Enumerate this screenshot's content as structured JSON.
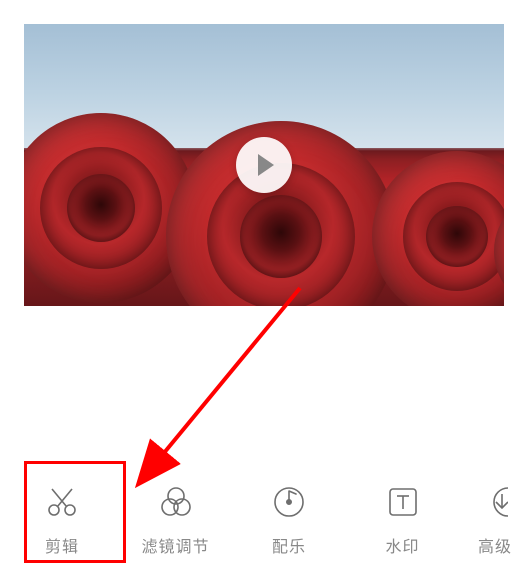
{
  "video": {
    "play_icon_name": "play-icon"
  },
  "toolbar": {
    "items": [
      {
        "label": "剪辑",
        "icon": "scissors-icon"
      },
      {
        "label": "滤镜调节",
        "icon": "filter-icon"
      },
      {
        "label": "配乐",
        "icon": "music-disc-icon"
      },
      {
        "label": "水印",
        "icon": "text-watermark-icon"
      },
      {
        "label": "高级",
        "icon": "download-circle-icon"
      }
    ]
  },
  "annotation": {
    "highlight_color": "#ff0000"
  }
}
